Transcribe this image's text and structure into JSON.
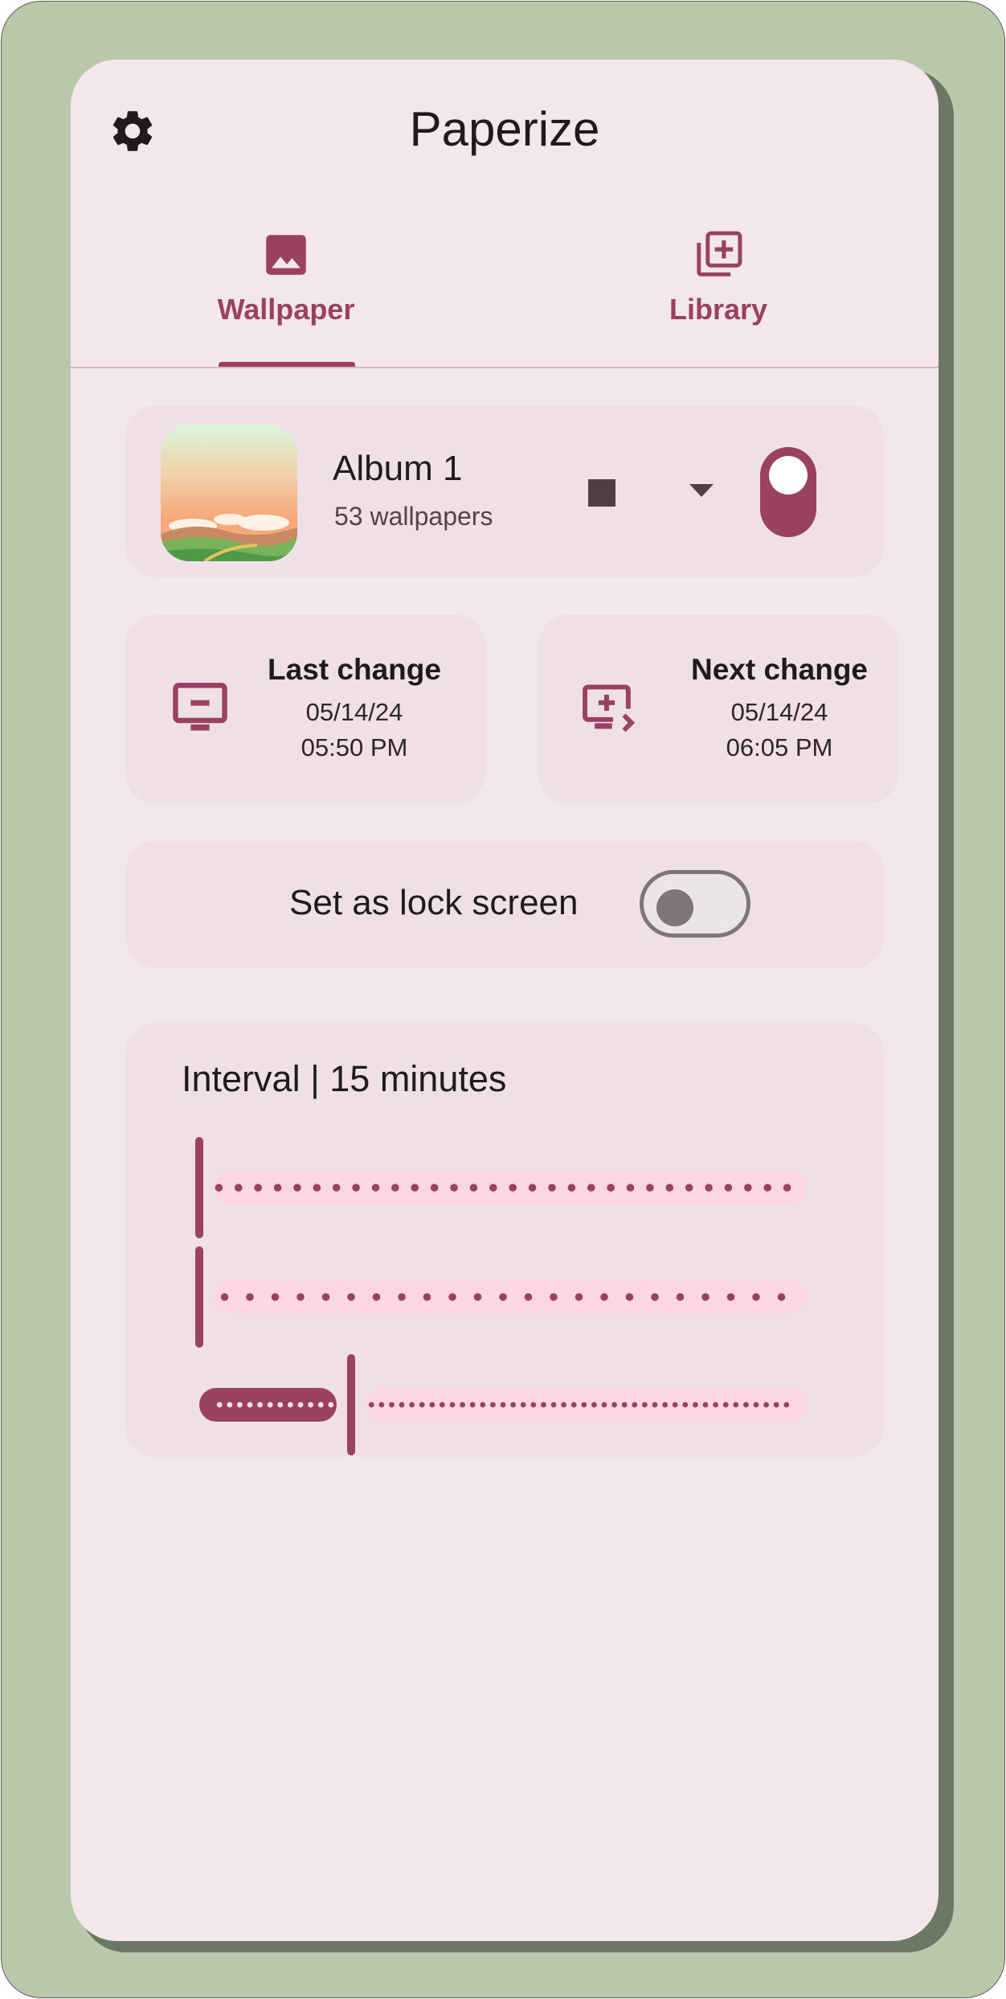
{
  "app": {
    "title": "Paperize"
  },
  "tabs": [
    {
      "label": "Wallpaper",
      "icon": "image-icon",
      "selected": true
    },
    {
      "label": "Library",
      "icon": "add-library-icon",
      "selected": false
    }
  ],
  "album": {
    "name": "Album 1",
    "count": "53 wallpapers",
    "enabled": true
  },
  "last_change": {
    "title": "Last change",
    "date": "05/14/24",
    "time": "05:50 PM"
  },
  "next_change": {
    "title": "Next change",
    "date": "05/14/24",
    "time": "06:05 PM"
  },
  "lock_screen": {
    "label": "Set as lock screen",
    "enabled": false
  },
  "interval": {
    "title": "Interval | 15 minutes",
    "sliders": [
      {
        "unit": "days",
        "value": 0,
        "max": 31,
        "steps": 31
      },
      {
        "unit": "hours",
        "value": 0,
        "max": 24,
        "steps": 24
      },
      {
        "unit": "minutes",
        "value": 15,
        "max": 60,
        "steps": 60
      }
    ]
  },
  "colors": {
    "background": "#b9c8aa",
    "surface": "#f3e7ec",
    "card": "#efdfe6",
    "accent": "#9a4162",
    "track": "#fcd7e3"
  }
}
